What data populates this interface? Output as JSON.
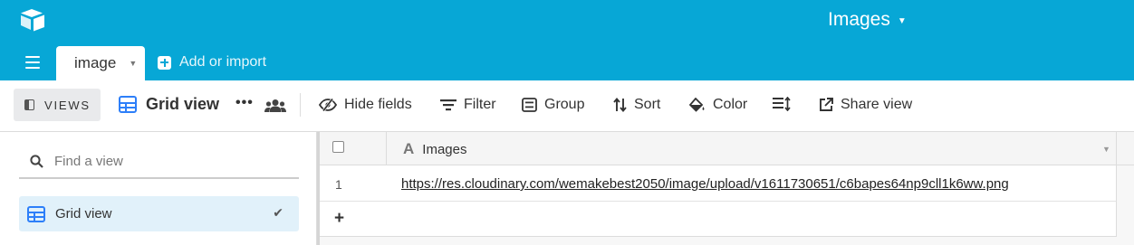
{
  "app": {
    "logo_icon": "airtable-logo-icon",
    "base_title": "Images",
    "accent_color": "#07a7d6",
    "view_icon_color": "#2d7ff9"
  },
  "tabs": {
    "menu_icon": "hamburger-icon",
    "active_table": "image",
    "add_import_label": "Add or import"
  },
  "toolbar": {
    "views_label": "VIEWS",
    "current_view": "Grid view",
    "more_label": "•••",
    "hide_fields": "Hide fields",
    "filter": "Filter",
    "group": "Group",
    "sort": "Sort",
    "color": "Color",
    "share_view": "Share view"
  },
  "sidebar": {
    "search_placeholder": "Find a view",
    "items": [
      {
        "label": "Grid view",
        "selected": true
      }
    ]
  },
  "grid": {
    "columns": [
      {
        "name": "Images",
        "type_icon": "text-field-icon"
      }
    ],
    "rows": [
      {
        "number": "1",
        "cells": [
          "https://res.cloudinary.com/wemakebest2050/image/upload/v1611730651/c6bapes64np9cll1k6ww.png"
        ]
      }
    ],
    "add_row_label": "+"
  }
}
